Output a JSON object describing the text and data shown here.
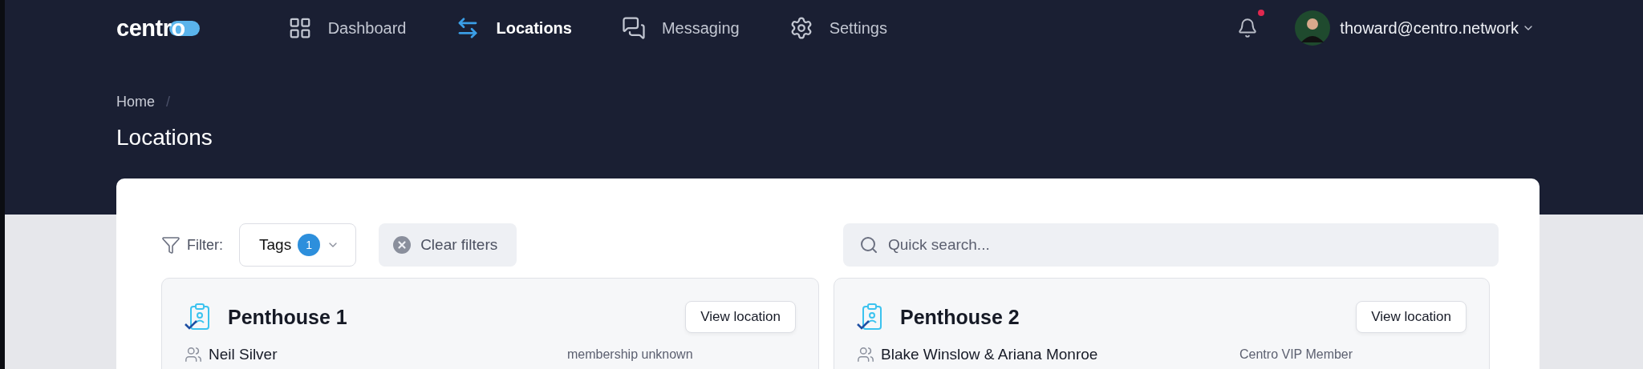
{
  "brand": {
    "logo": "centro"
  },
  "nav": [
    {
      "label": "Dashboard",
      "kind": "grid",
      "selected": false
    },
    {
      "label": "Locations",
      "kind": "arrows",
      "selected": true
    },
    {
      "label": "Messaging",
      "kind": "chat",
      "selected": false
    },
    {
      "label": "Settings",
      "kind": "gear",
      "selected": false
    }
  ],
  "notifications": {
    "unread": true
  },
  "user": {
    "email": "thoward@centro.network"
  },
  "breadcrumb": [
    {
      "label": "Home"
    },
    {
      "label": "/"
    }
  ],
  "page_title": "Locations",
  "filter": {
    "label": "Filter:",
    "tags": {
      "label": "Tags",
      "count": "1"
    },
    "clear": "Clear filters"
  },
  "search": {
    "placeholder": "Quick search..."
  },
  "locations": [
    {
      "name": "Penthouse 1",
      "action": "View location",
      "residents": "Neil Silver",
      "membership": "membership unknown"
    },
    {
      "name": "Penthouse 2",
      "action": "View location",
      "residents": "Blake Winslow & Ariana Monroe",
      "membership": "Centro VIP Member"
    }
  ]
}
